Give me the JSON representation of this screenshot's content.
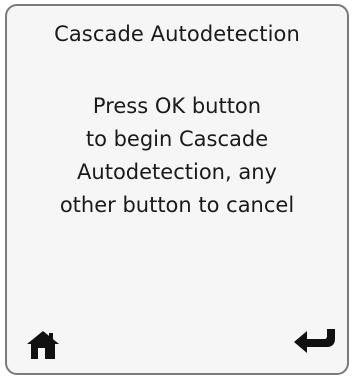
{
  "screen": {
    "title": "Cascade Autodetection",
    "message_lines": [
      "Press OK button",
      "to begin Cascade",
      "Autodetection, any",
      "other button to cancel"
    ]
  },
  "footer": {
    "left_icon": "home-icon",
    "right_icon": "return-arrow-icon"
  }
}
